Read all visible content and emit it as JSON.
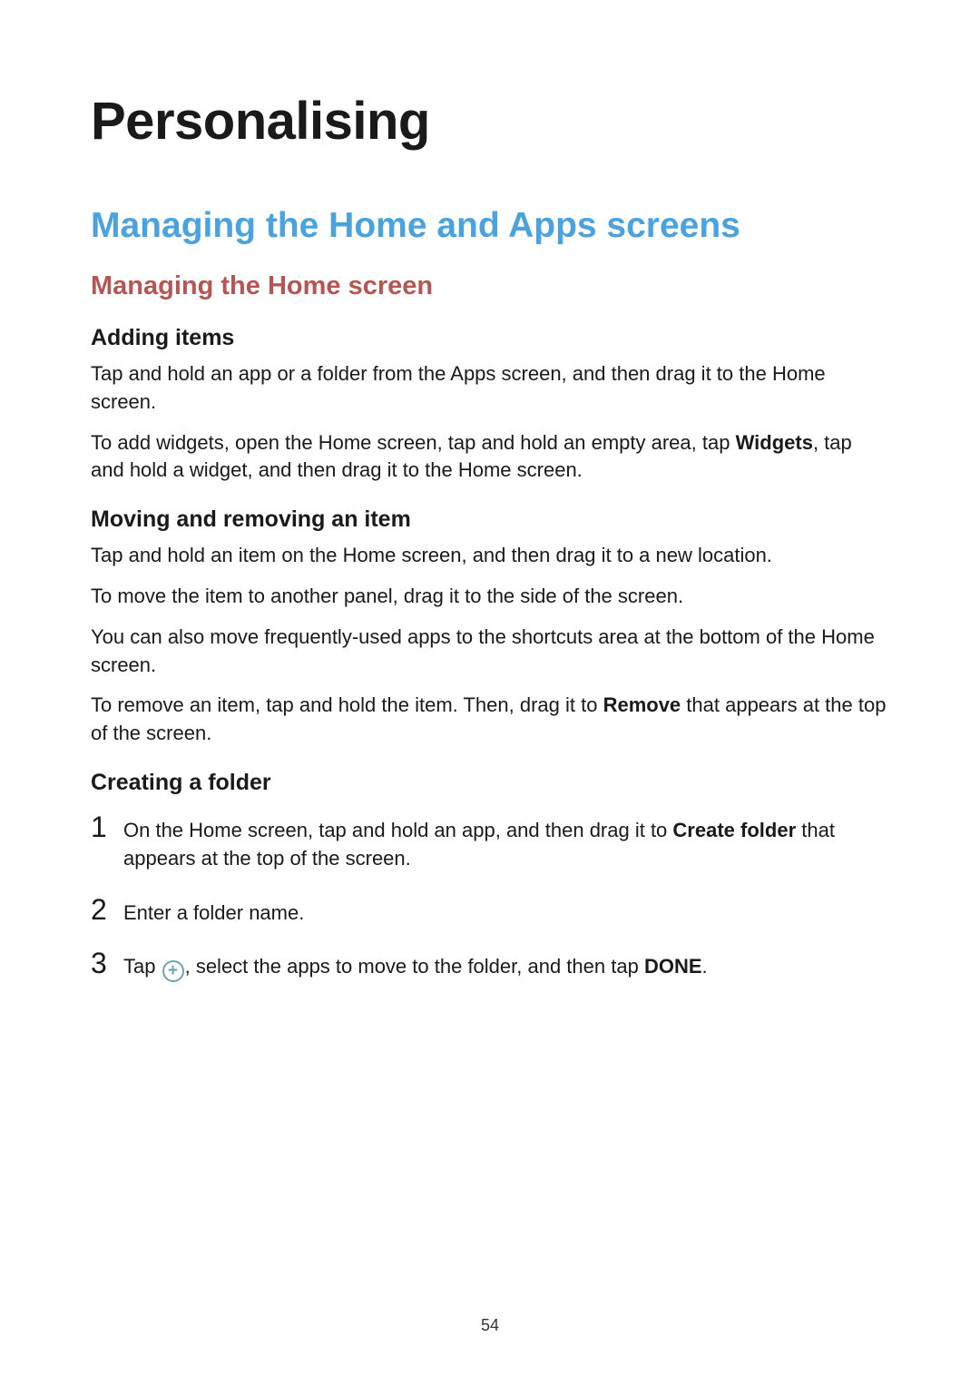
{
  "page": {
    "title": "Personalising",
    "section_title": "Managing the Home and Apps screens",
    "subsection_title": "Managing the Home screen",
    "blocks": {
      "adding_items": {
        "heading": "Adding items",
        "p1": "Tap and hold an app or a folder from the Apps screen, and then drag it to the Home screen.",
        "p2_a": "To add widgets, open the Home screen, tap and hold an empty area, tap ",
        "p2_bold": "Widgets",
        "p2_b": ", tap and hold a widget, and then drag it to the Home screen."
      },
      "moving_removing": {
        "heading": "Moving and removing an item",
        "p1": "Tap and hold an item on the Home screen, and then drag it to a new location.",
        "p2": "To move the item to another panel, drag it to the side of the screen.",
        "p3": "You can also move frequently-used apps to the shortcuts area at the bottom of the Home screen.",
        "p4_a": "To remove an item, tap and hold the item. Then, drag it to ",
        "p4_bold": "Remove",
        "p4_b": " that appears at the top of the screen."
      },
      "creating_folder": {
        "heading": "Creating a folder",
        "steps": {
          "s1": {
            "num": "1",
            "a": "On the Home screen, tap and hold an app, and then drag it to ",
            "bold": "Create folder",
            "b": " that appears at the top of the screen."
          },
          "s2": {
            "num": "2",
            "text": "Enter a folder name."
          },
          "s3": {
            "num": "3",
            "a": "Tap ",
            "icon": "+",
            "b": ", select the apps to move to the folder, and then tap ",
            "bold": "DONE",
            "c": "."
          }
        }
      }
    },
    "number": "54"
  }
}
